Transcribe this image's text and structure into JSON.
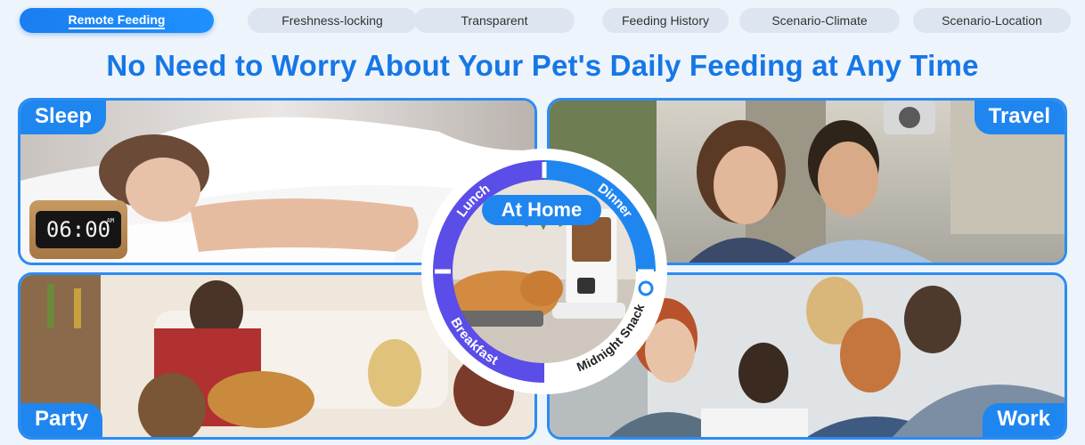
{
  "tabs": [
    {
      "label": "Remote Feeding",
      "active": true
    },
    {
      "label": "Freshness-locking",
      "active": false
    },
    {
      "label": "Transparent",
      "active": false
    },
    {
      "label": "Feeding History",
      "active": false
    },
    {
      "label": "Scenario-Climate",
      "active": false
    },
    {
      "label": "Scenario-Location",
      "active": false
    }
  ],
  "headline": "No Need to Worry About Your Pet's Daily Feeding at Any Time",
  "panels": {
    "sleep": {
      "label": "Sleep",
      "clock_time": "06:00",
      "clock_ampm": "AM"
    },
    "travel": {
      "label": "Travel"
    },
    "party": {
      "label": "Party"
    },
    "work": {
      "label": "Work"
    }
  },
  "center": {
    "title": "At Home",
    "meals": {
      "lunch": "Lunch",
      "dinner": "Dinner",
      "breakfast": "Breakfast",
      "midnight": "Midnight Snack"
    }
  },
  "colors": {
    "accent": "#1f86f0",
    "headline": "#1677e6",
    "ring_purple": "#5b4de8",
    "ring_blue": "#1f86f0"
  }
}
